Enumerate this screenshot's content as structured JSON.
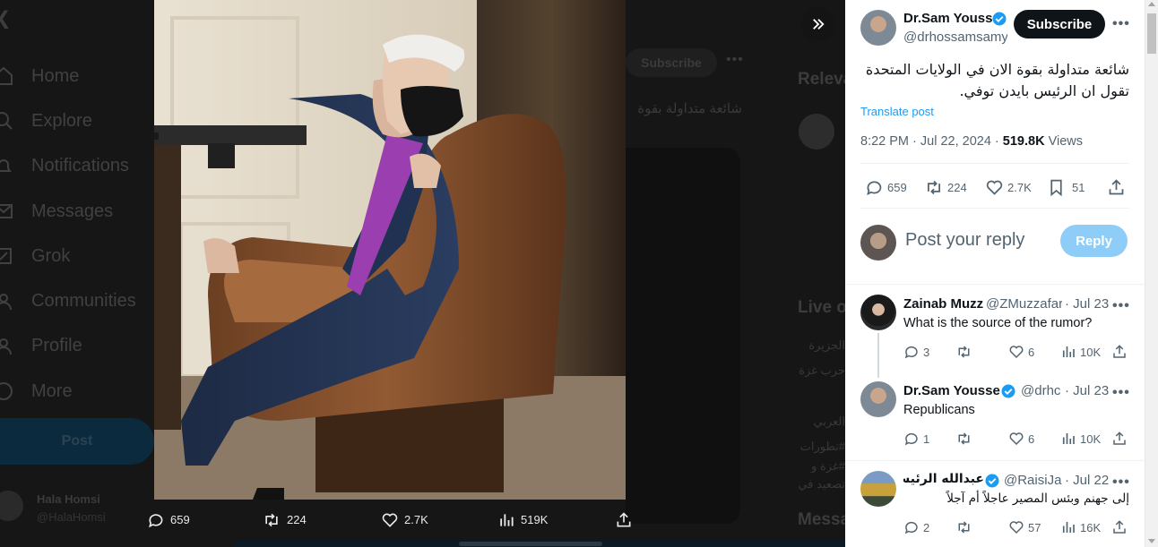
{
  "background": {
    "nav": [
      "Home",
      "Explore",
      "Notifications",
      "Messages",
      "Grok",
      "Communities",
      "Profile",
      "More"
    ],
    "post_button": "Post",
    "account": {
      "name": "Hala Homsi",
      "handle": "@HalaHomsi"
    },
    "subscribe": "Subscribe",
    "snippet": "شائعة متداولة بقوة",
    "right_headings": [
      "Relevant people",
      "Live on X",
      "Messages"
    ],
    "right_snippets": [
      "الجزيرة",
      "حرب غزة",
      "العربي",
      "#تطورات",
      "#غزة و",
      "تصعيد في"
    ]
  },
  "media_bar": {
    "replies": "659",
    "reposts": "224",
    "likes": "2.7K",
    "views": "519K"
  },
  "post": {
    "author_name": "Dr.Sam Youss",
    "handle": "@drhossamsamy",
    "subscribe": "Subscribe",
    "text": "شائعة متداولة بقوة الان في الولايات المتحدة تقول ان الرئيس بايدن توفي.",
    "translate": "Translate post",
    "time": "8:22 PM · Jul 22, 2024 · ",
    "views_count": "519.8K",
    "views_label": " Views",
    "stats": {
      "replies": "659",
      "reposts": "224",
      "likes": "2.7K",
      "bookmarks": "51"
    }
  },
  "composer": {
    "placeholder": "Post your reply",
    "button": "Reply"
  },
  "replies": [
    {
      "name": "Zainab Muzz",
      "handle": "@ZMuzzafar",
      "date": "· Jul 23",
      "text": "What is the source of the rumor?",
      "replies": "3",
      "reposts": "",
      "likes": "6",
      "views": "10K"
    },
    {
      "name": "Dr.Sam Yousse",
      "handle": "@drhc",
      "date": "· Jul 23",
      "text": "Republicans",
      "replies": "1",
      "reposts": "",
      "likes": "6",
      "views": "10K"
    },
    {
      "name": "عبدالله الرئيسي",
      "handle": "@RaisiJa",
      "date": "· Jul 22",
      "text": "إلى جهنم وبئس المصير عاجلاً أم آجلاً",
      "replies": "2",
      "reposts": "",
      "likes": "57",
      "views": "16K"
    }
  ],
  "colors": {
    "accent": "#1d9bf0",
    "reply_disabled": "#8ecdf7",
    "text": "#0f1419",
    "muted": "#536471"
  }
}
